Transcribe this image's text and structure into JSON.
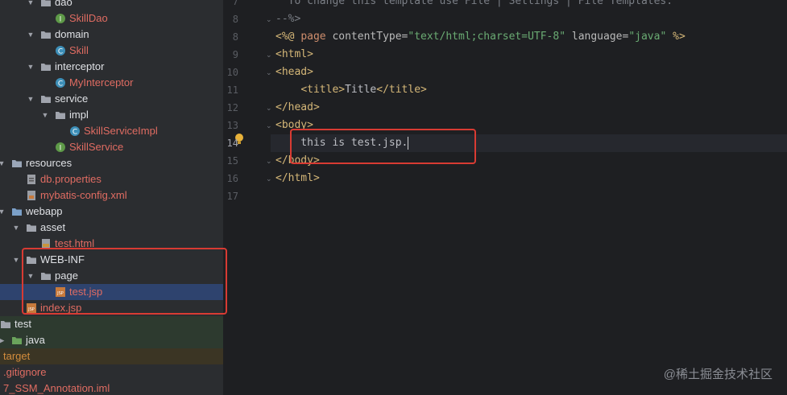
{
  "project_tree": {
    "items": [
      {
        "label": "dao",
        "icon": "folder-icon",
        "arrow": "down",
        "color": "normal"
      },
      {
        "label": "SkillDao",
        "icon": "interface-icon",
        "arrow": "",
        "color": "red"
      },
      {
        "label": "domain",
        "icon": "folder-icon",
        "arrow": "down",
        "color": "normal"
      },
      {
        "label": "Skill",
        "icon": "class-icon",
        "arrow": "",
        "color": "red"
      },
      {
        "label": "interceptor",
        "icon": "folder-icon",
        "arrow": "down",
        "color": "normal"
      },
      {
        "label": "MyInterceptor",
        "icon": "class-icon",
        "arrow": "",
        "color": "red"
      },
      {
        "label": "service",
        "icon": "folder-icon",
        "arrow": "down",
        "color": "normal"
      },
      {
        "label": "impl",
        "icon": "folder-icon",
        "arrow": "down",
        "color": "normal"
      },
      {
        "label": "SkillServiceImpl",
        "icon": "class-icon",
        "arrow": "",
        "color": "red"
      },
      {
        "label": "SkillService",
        "icon": "interface-icon",
        "arrow": "",
        "color": "red"
      },
      {
        "label": "resources",
        "icon": "resources-folder-icon",
        "arrow": "down",
        "color": "normal"
      },
      {
        "label": "db.properties",
        "icon": "properties-file-icon",
        "arrow": "",
        "color": "red"
      },
      {
        "label": "mybatis-config.xml",
        "icon": "xml-file-icon",
        "arrow": "",
        "color": "red"
      },
      {
        "label": "webapp",
        "icon": "web-folder-icon",
        "arrow": "down",
        "color": "normal"
      },
      {
        "label": "asset",
        "icon": "folder-icon",
        "arrow": "down",
        "color": "normal"
      },
      {
        "label": "test.html",
        "icon": "html-file-icon",
        "arrow": "",
        "color": "red"
      },
      {
        "label": "WEB-INF",
        "icon": "folder-icon",
        "arrow": "down",
        "color": "normal"
      },
      {
        "label": "page",
        "icon": "folder-icon",
        "arrow": "down",
        "color": "normal"
      },
      {
        "label": "test.jsp",
        "icon": "jsp-file-icon",
        "arrow": "",
        "color": "red",
        "selected": true
      },
      {
        "label": "index.jsp",
        "icon": "jsp-file-icon",
        "arrow": "",
        "color": "red"
      },
      {
        "label": "test",
        "icon": "folder-icon",
        "arrow": "down",
        "color": "normal"
      },
      {
        "label": "java",
        "icon": "test-folder-icon",
        "arrow": "right",
        "color": "normal"
      },
      {
        "label": "target",
        "icon": "folder-icon",
        "arrow": "",
        "color": "orange"
      },
      {
        "label": ".gitignore",
        "icon": "gitignore-file-icon",
        "arrow": "",
        "color": "red"
      },
      {
        "label": "7_SSM_Annotation.iml",
        "icon": "iml-file-icon",
        "arrow": "",
        "color": "red"
      }
    ]
  },
  "editor": {
    "lines": [
      {
        "num": "7",
        "parts": [
          {
            "t": "  To change this template use File | Settings | File Templates.",
            "c": "cmt"
          }
        ]
      },
      {
        "num": "8",
        "parts": [
          {
            "t": "--%>",
            "c": "cmt"
          }
        ]
      },
      {
        "num": "8",
        "parts": [
          {
            "t": "<%@ ",
            "c": "tag"
          },
          {
            "t": "page ",
            "c": "kw"
          },
          {
            "t": "contentType=",
            "c": "attr"
          },
          {
            "t": "\"text/html;charset=UTF-8\"",
            "c": "str"
          },
          {
            "t": " language=",
            "c": "attr"
          },
          {
            "t": "\"java\"",
            "c": "str"
          },
          {
            "t": " %>",
            "c": "tag"
          }
        ]
      },
      {
        "num": "9",
        "parts": [
          {
            "t": "<html>",
            "c": "tag"
          }
        ]
      },
      {
        "num": "10",
        "parts": [
          {
            "t": "<head>",
            "c": "tag"
          }
        ]
      },
      {
        "num": "11",
        "parts": [
          {
            "t": "    ",
            "c": ""
          },
          {
            "t": "<title>",
            "c": "tag"
          },
          {
            "t": "Title",
            "c": ""
          },
          {
            "t": "</title>",
            "c": "tag"
          }
        ]
      },
      {
        "num": "12",
        "parts": [
          {
            "t": "</head>",
            "c": "tag"
          }
        ]
      },
      {
        "num": "13",
        "parts": [
          {
            "t": "<body>",
            "c": "tag"
          }
        ]
      },
      {
        "num": "14",
        "parts": [
          {
            "t": "    this is test.jsp.",
            "c": ""
          }
        ],
        "current": true
      },
      {
        "num": "15",
        "parts": [
          {
            "t": "</body>",
            "c": "tag"
          }
        ]
      },
      {
        "num": "16",
        "parts": [
          {
            "t": "</html>",
            "c": "tag"
          }
        ]
      },
      {
        "num": "17",
        "parts": []
      }
    ]
  },
  "watermark": "@稀土掘金技术社区",
  "colors": {
    "highlight": "#d83b33",
    "selection": "#2e436e"
  }
}
